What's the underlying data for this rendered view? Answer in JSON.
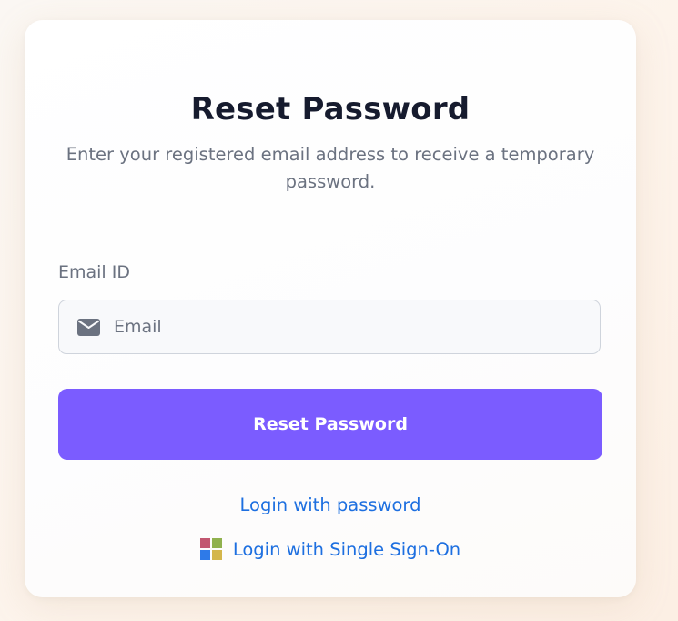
{
  "card": {
    "title": "Reset Password",
    "subtitle": "Enter your registered email address to receive a temporary password."
  },
  "email_field": {
    "label": "Email ID",
    "placeholder": "Email",
    "value": "",
    "icon": "envelope-icon"
  },
  "actions": {
    "reset_label": "Reset Password",
    "login_password_label": "Login with password",
    "login_sso_label": "Login with Single Sign-On",
    "sso_icon": "microsoft-logo-icon"
  },
  "colors": {
    "accent": "#7b5cff",
    "link": "#1d6fe0",
    "title": "#161b2e",
    "muted": "#6b7280",
    "ms_red": "#c25770",
    "ms_green": "#90b14e",
    "ms_blue": "#2e7ae8",
    "ms_yellow": "#d4b64b"
  }
}
